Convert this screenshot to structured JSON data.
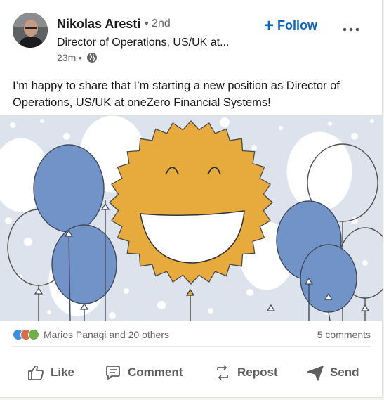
{
  "post": {
    "author": {
      "name": "Nikolas Aresti",
      "degree": "• 2nd",
      "headline": "Director of Operations, US/UK at...",
      "timestamp": "23m •",
      "globe_icon": "globe-icon"
    },
    "follow_label": "Follow",
    "more_icon": "more-horizontal-icon",
    "text": "I’m happy to share that I’m starting a new position as Director of Operations, US/UK at oneZero Financial Systems!",
    "image_icon": "smiley-balloons-illustration"
  },
  "social": {
    "reactions": [
      "like-reaction",
      "celebrate-reaction",
      "support-reaction"
    ],
    "reactors": "Marios Panagi and 20 others",
    "comments": "5 comments"
  },
  "actions": {
    "like": "Like",
    "comment": "Comment",
    "repost": "Repost",
    "send": "Send"
  },
  "colors": {
    "accent": "#0a66c2",
    "balloon_blue": "#7193c8",
    "sun_yellow": "#e7ab3d",
    "image_bg": "#dde3ec"
  }
}
